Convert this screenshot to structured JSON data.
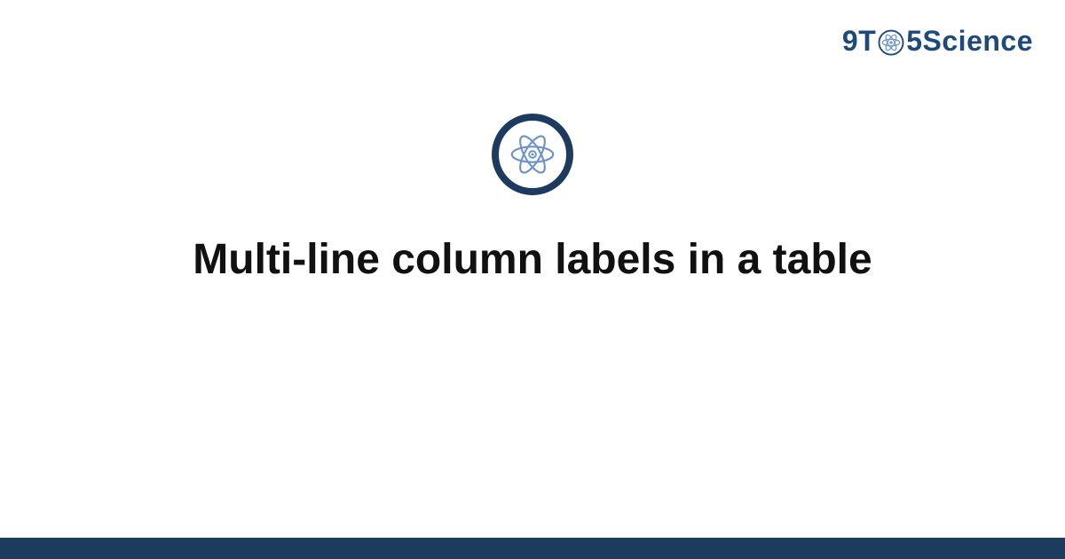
{
  "brand": {
    "part1": "9T",
    "part2": "5Science"
  },
  "title": "Multi-line column labels in a table",
  "colors": {
    "brand_text": "#1d4a7a",
    "icon_ring": "#1d3b5e",
    "icon_inner": "#6b93c9",
    "footer": "#1d3b5e"
  }
}
